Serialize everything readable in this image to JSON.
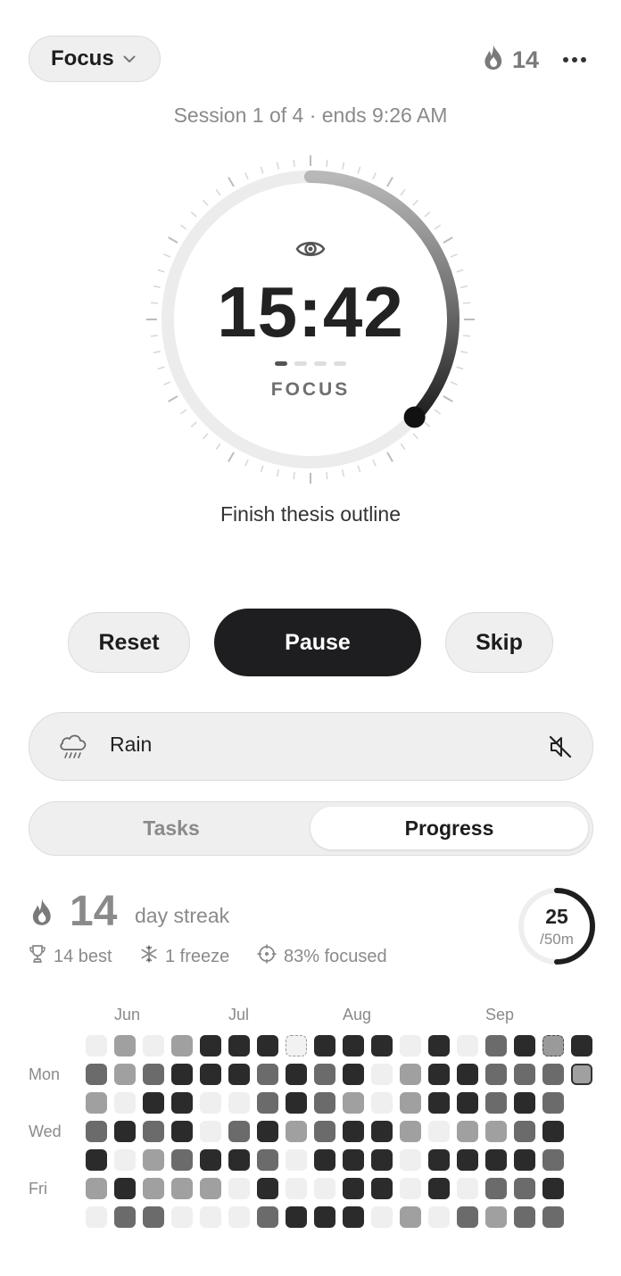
{
  "header": {
    "mode_label": "Focus",
    "streak_count": "14"
  },
  "session_info": "Session 1 of 4 · ends 9:26 AM",
  "timer": {
    "time": "15:42",
    "phase": "FOCUS",
    "progress_fraction": 0.37,
    "sessions_total": 4,
    "session_current": 1,
    "task": "Finish thesis outline"
  },
  "controls": {
    "reset": "Reset",
    "pause": "Pause",
    "skip": "Skip"
  },
  "sound": {
    "label": "Rain",
    "muted": true
  },
  "tabs": [
    {
      "label": "Tasks",
      "active": false
    },
    {
      "label": "Progress",
      "active": true
    }
  ],
  "progress": {
    "streak_number": "14",
    "streak_label": "day streak",
    "best": "14 best",
    "freeze": "1 freeze",
    "focused": "83% focused",
    "today_minutes": "25",
    "today_goal": "/50m",
    "today_fraction": 0.5
  },
  "heatmap": {
    "months": [
      "Jun",
      "Jul",
      "Aug",
      "Sep"
    ],
    "day_labels": [
      "Mon",
      "Wed",
      "Fri"
    ],
    "legend": "0=empty,1=light,2=medium,3=dark,f=freeze,fd=freeze-used,t=today",
    "weeks": [
      [
        "0",
        "2",
        "1",
        "2",
        "3",
        "1",
        "0"
      ],
      [
        "1",
        "1",
        "0",
        "3",
        "0",
        "3",
        "2"
      ],
      [
        "0",
        "2",
        "3",
        "2",
        "1",
        "1",
        "2"
      ],
      [
        "1",
        "3",
        "3",
        "3",
        "2",
        "1",
        "0"
      ],
      [
        "3",
        "3",
        "0",
        "0",
        "3",
        "1",
        "0"
      ],
      [
        "3",
        "3",
        "0",
        "2",
        "3",
        "0",
        "0"
      ],
      [
        "3",
        "2",
        "2",
        "3",
        "2",
        "3",
        "2"
      ],
      [
        "f",
        "3",
        "3",
        "1",
        "0",
        "0",
        "3"
      ],
      [
        "3",
        "2",
        "2",
        "2",
        "3",
        "0",
        "3"
      ],
      [
        "3",
        "3",
        "1",
        "3",
        "3",
        "3",
        "3"
      ],
      [
        "3",
        "0",
        "0",
        "3",
        "3",
        "3",
        "0"
      ],
      [
        "0",
        "1",
        "1",
        "1",
        "0",
        "0",
        "1"
      ],
      [
        "3",
        "3",
        "3",
        "0",
        "3",
        "3",
        "0"
      ],
      [
        "0",
        "3",
        "3",
        "1",
        "3",
        "0",
        "2"
      ],
      [
        "2",
        "2",
        "2",
        "1",
        "3",
        "2",
        "1"
      ],
      [
        "3",
        "2",
        "3",
        "2",
        "3",
        "2",
        "2"
      ],
      [
        "fd",
        "2",
        "2",
        "3",
        "2",
        "3",
        "2"
      ],
      [
        "3",
        "t"
      ]
    ]
  }
}
